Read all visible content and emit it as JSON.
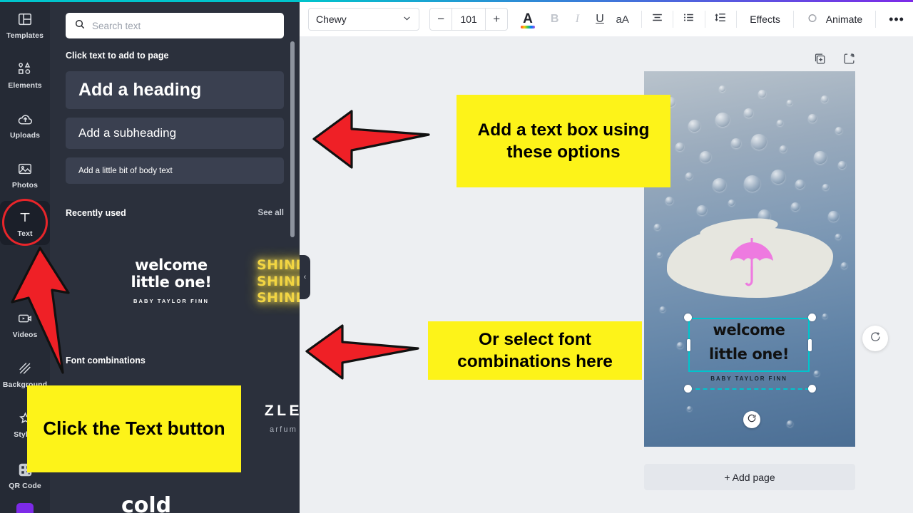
{
  "colors": {
    "accent_teal": "#00c4cc",
    "accent_purple": "#7d2ae8",
    "rail_bg": "#252a35",
    "panel_bg": "#2b303c",
    "workspace_bg": "#edeff2",
    "callout_yellow": "#fdf319",
    "annotation_red": "#e8252a",
    "umbrella_pink": "#ee7ae0",
    "brush_cream": "#e6e6df"
  },
  "sidebar": {
    "items": [
      {
        "label": "Templates",
        "icon": "templates-icon",
        "active": false
      },
      {
        "label": "Elements",
        "icon": "elements-icon",
        "active": false
      },
      {
        "label": "Uploads",
        "icon": "uploads-icon",
        "active": false
      },
      {
        "label": "Photos",
        "icon": "photos-icon",
        "active": false
      },
      {
        "label": "Text",
        "icon": "text-icon",
        "active": true
      },
      {
        "label": "Videos",
        "icon": "videos-icon",
        "active": false
      },
      {
        "label": "Background",
        "icon": "background-icon",
        "active": false
      },
      {
        "label": "Styles",
        "icon": "styles-star-icon",
        "active": false
      },
      {
        "label": "QR Code",
        "icon": "qr-code-icon",
        "active": false
      }
    ]
  },
  "panel": {
    "search": {
      "placeholder": "Search text",
      "value": ""
    },
    "section_click_text": "Click text to add to page",
    "text_options": [
      {
        "label": "Add a heading"
      },
      {
        "label": "Add a subheading"
      },
      {
        "label": "Add a little bit of body text"
      }
    ],
    "recently_used": {
      "title": "Recently used",
      "see_all": "See all",
      "thumbs": [
        {
          "line1": "welcome",
          "line2": "little one!",
          "sub": "BABY TAYLOR FINN"
        },
        {
          "line1": "SHINE",
          "line2": "SHINE",
          "line3": "SHINE"
        }
      ],
      "next_arrow": "›"
    },
    "font_combinations": {
      "title": "Font combinations",
      "thumbs": [
        {
          "main": "ZLE",
          "sub": "arfum"
        },
        {
          "main": "cold"
        }
      ]
    }
  },
  "toolbar": {
    "font_family": "Chewy",
    "font_size": "101",
    "decrease": "−",
    "increase": "+",
    "text_color_label": "A",
    "bold": "B",
    "italic": "I",
    "underline": "U",
    "case": "aA",
    "align_icon": "align-icon",
    "list_icon": "bullet-list-icon",
    "spacing_icon": "line-spacing-icon",
    "effects": "Effects",
    "animate": "Animate",
    "more": "•••"
  },
  "canvas": {
    "page_tools": [
      {
        "icon": "duplicate-page-icon"
      },
      {
        "icon": "add-page-icon"
      }
    ],
    "selected_text": {
      "line1": "welcome",
      "line2": "little one!",
      "subtitle": "BABY TAYLOR FINN"
    },
    "add_page_label": "+ Add page",
    "comment_icon": "add-comment-icon",
    "rotate_icon": "rotate-handle-icon"
  },
  "annotations": {
    "callout_1": "Add a text box using these options",
    "callout_2": "Or select font combinations here",
    "callout_3": "Click the Text button"
  }
}
